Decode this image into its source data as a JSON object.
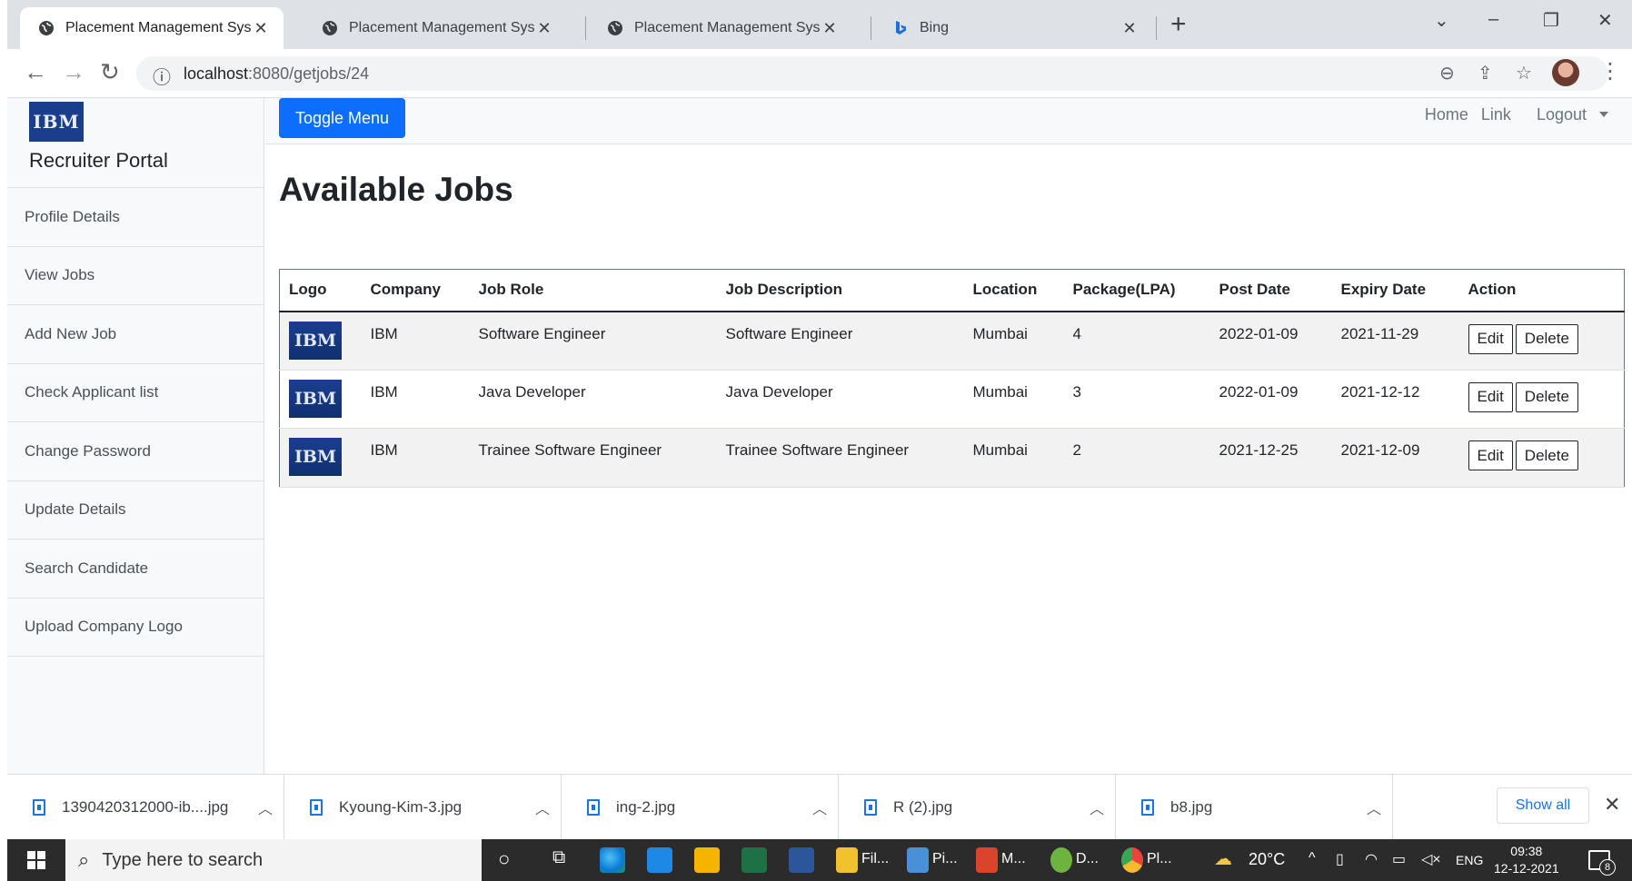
{
  "browser": {
    "tabs": [
      {
        "title": "Placement Management System",
        "active": true,
        "icon": "globe-icon"
      },
      {
        "title": "Placement Management System",
        "active": false,
        "icon": "globe-icon"
      },
      {
        "title": "Placement Management System",
        "active": false,
        "icon": "globe-icon"
      },
      {
        "title": "Bing",
        "active": false,
        "icon": "bing-icon"
      }
    ],
    "url_host": "localhost",
    "url_path": ":8080/getjobs/24"
  },
  "sidebar": {
    "logo_text": "IBM",
    "title": "Recruiter Portal",
    "items": [
      {
        "label": "Profile Details"
      },
      {
        "label": "View Jobs"
      },
      {
        "label": "Add New Job"
      },
      {
        "label": "Check Applicant list"
      },
      {
        "label": "Change Password"
      },
      {
        "label": "Update Details"
      },
      {
        "label": "Search Candidate"
      },
      {
        "label": "Upload Company Logo"
      }
    ]
  },
  "topnav": {
    "toggle_label": "Toggle Menu",
    "home": "Home",
    "link": "Link",
    "logout": "Logout"
  },
  "main": {
    "title": "Available Jobs",
    "table": {
      "headers": [
        "Logo",
        "Company",
        "Job Role",
        "Job Description",
        "Location",
        "Package(LPA)",
        "Post Date",
        "Expiry Date",
        "Action"
      ],
      "rows": [
        {
          "logo": "IBM",
          "company": "IBM",
          "role": "Software Engineer",
          "description": "Software Engineer",
          "location": "Mumbai",
          "package": "4",
          "post_date": "2022-01-09",
          "expiry_date": "2021-11-29"
        },
        {
          "logo": "IBM",
          "company": "IBM",
          "role": "Java Developer",
          "description": "Java Developer",
          "location": "Mumbai",
          "package": "3",
          "post_date": "2022-01-09",
          "expiry_date": "2021-12-12"
        },
        {
          "logo": "IBM",
          "company": "IBM",
          "role": "Trainee Software Engineer",
          "description": "Trainee Software Engineer",
          "location": "Mumbai",
          "package": "2",
          "post_date": "2021-12-25",
          "expiry_date": "2021-12-09"
        }
      ],
      "edit_label": "Edit",
      "delete_label": "Delete"
    }
  },
  "downloads": {
    "items": [
      {
        "name": "1390420312000-ib....jpg"
      },
      {
        "name": "Kyoung-Kim-3.jpg"
      },
      {
        "name": "ing-2.jpg"
      },
      {
        "name": "R (2).jpg"
      },
      {
        "name": "b8.jpg"
      }
    ],
    "show_all": "Show all"
  },
  "taskbar": {
    "search_placeholder": "Type here to search",
    "apps": [
      {
        "label": "Fil...",
        "color": "#f2c12e"
      },
      {
        "label": "Pi...",
        "color": "#4a90d9"
      },
      {
        "label": "M...",
        "color": "#d9442b"
      },
      {
        "label": "D...",
        "color": "#6db33f"
      },
      {
        "label": "Pl...",
        "color": "#e8453c"
      }
    ],
    "temperature": "20°C",
    "language": "ENG",
    "time": "09:38",
    "date": "12-12-2021",
    "notification_count": "8"
  }
}
